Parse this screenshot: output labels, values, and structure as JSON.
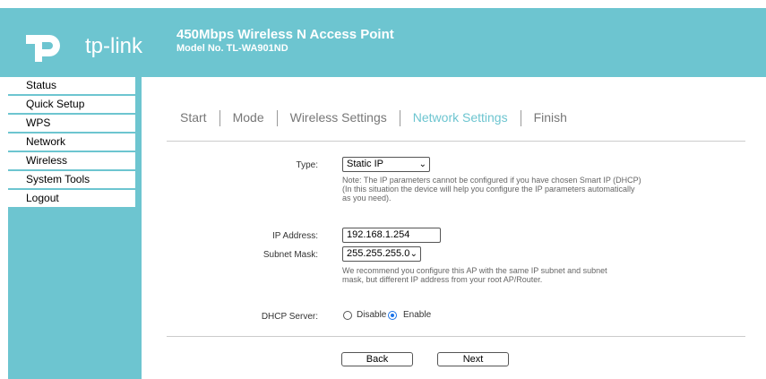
{
  "brand": {
    "logo_text": "tp-link"
  },
  "header": {
    "title": "450Mbps Wireless N Access Point",
    "model": "Model No. TL-WA901ND",
    "color": "#6dc5d0"
  },
  "sidebar": {
    "items": [
      {
        "label": "Status"
      },
      {
        "label": "Quick Setup"
      },
      {
        "label": "WPS"
      },
      {
        "label": "Network"
      },
      {
        "label": "Wireless"
      },
      {
        "label": "System Tools"
      },
      {
        "label": "Logout"
      }
    ]
  },
  "steps": [
    {
      "label": "Start"
    },
    {
      "label": "Mode"
    },
    {
      "label": "Wireless Settings"
    },
    {
      "label": "Network Settings"
    },
    {
      "label": "Finish"
    }
  ],
  "form": {
    "type_label": "Type:",
    "type_value": "Static IP",
    "type_note_1": "Note: The IP parameters cannot be configured if you have chosen Smart IP (DHCP)",
    "type_note_2": "(In this situation the device will help you configure the IP parameters automatically",
    "type_note_3": "as you need).",
    "ip_label": "IP Address:",
    "ip_value": "192.168.1.254",
    "mask_label": "Subnet Mask:",
    "mask_value": "255.255.255.0",
    "mask_note_1": "We recommend you configure this AP with the same IP subnet and subnet",
    "mask_note_2": "mask, but different IP address from your root AP/Router.",
    "dhcp_label": "DHCP Server:",
    "dhcp_disable": "Disable",
    "dhcp_enable": "Enable",
    "dhcp_selected": "Enable"
  },
  "buttons": {
    "back": "Back",
    "next": "Next"
  }
}
